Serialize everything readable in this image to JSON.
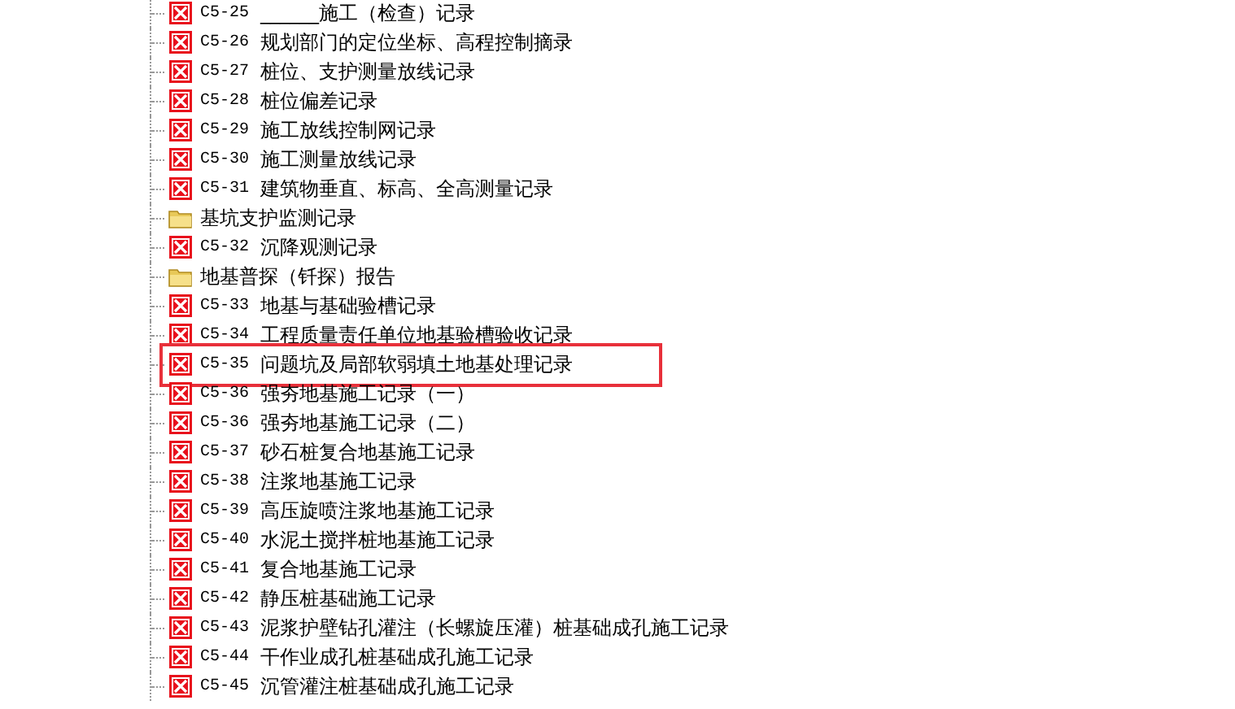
{
  "tree": {
    "items": [
      {
        "kind": "form",
        "code": "C5-25",
        "title": "______施工（检查）记录",
        "selected": false
      },
      {
        "kind": "form",
        "code": "C5-26",
        "title": "规划部门的定位坐标、高程控制摘录",
        "selected": false
      },
      {
        "kind": "form",
        "code": "C5-27",
        "title": "桩位、支护测量放线记录",
        "selected": false
      },
      {
        "kind": "form",
        "code": "C5-28",
        "title": "桩位偏差记录",
        "selected": false
      },
      {
        "kind": "form",
        "code": "C5-29",
        "title": "施工放线控制网记录",
        "selected": false
      },
      {
        "kind": "form",
        "code": "C5-30",
        "title": "施工测量放线记录",
        "selected": false
      },
      {
        "kind": "form",
        "code": "C5-31",
        "title": "建筑物垂直、标高、全高测量记录",
        "selected": false
      },
      {
        "kind": "folder",
        "title": "基坑支护监测记录",
        "selected": false
      },
      {
        "kind": "form",
        "code": "C5-32",
        "title": "沉降观测记录",
        "selected": false
      },
      {
        "kind": "folder",
        "title": "地基普探（钎探）报告",
        "selected": false
      },
      {
        "kind": "form",
        "code": "C5-33",
        "title": "地基与基础验槽记录",
        "selected": false
      },
      {
        "kind": "form",
        "code": "C5-34",
        "title": "工程质量责任单位地基验槽验收记录",
        "selected": false
      },
      {
        "kind": "form",
        "code": "C5-35",
        "title": "问题坑及局部软弱填土地基处理记录",
        "selected": true
      },
      {
        "kind": "form",
        "code": "C5-36",
        "title": "强夯地基施工记录（一）",
        "selected": false
      },
      {
        "kind": "form",
        "code": "C5-36",
        "title": "强夯地基施工记录（二）",
        "selected": false
      },
      {
        "kind": "form",
        "code": "C5-37",
        "title": "砂石桩复合地基施工记录",
        "selected": false
      },
      {
        "kind": "form",
        "code": "C5-38",
        "title": "注浆地基施工记录",
        "selected": false
      },
      {
        "kind": "form",
        "code": "C5-39",
        "title": "高压旋喷注浆地基施工记录",
        "selected": false
      },
      {
        "kind": "form",
        "code": "C5-40",
        "title": "水泥土搅拌桩地基施工记录",
        "selected": false
      },
      {
        "kind": "form",
        "code": "C5-41",
        "title": "复合地基施工记录",
        "selected": false
      },
      {
        "kind": "form",
        "code": "C5-42",
        "title": "静压桩基础施工记录",
        "selected": false
      },
      {
        "kind": "form",
        "code": "C5-43",
        "title": "泥浆护壁钻孔灌注（长螺旋压灌）桩基础成孔施工记录",
        "selected": false
      },
      {
        "kind": "form",
        "code": "C5-44",
        "title": "干作业成孔桩基础成孔施工记录",
        "selected": false
      },
      {
        "kind": "form",
        "code": "C5-45",
        "title": "沉管灌注桩基础成孔施工记录",
        "selected": false
      }
    ]
  }
}
